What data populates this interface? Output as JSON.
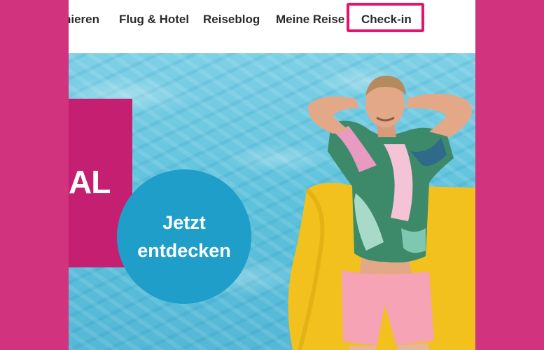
{
  "nav": {
    "items": [
      {
        "label": "hieren"
      },
      {
        "label": "Flug & Hotel"
      },
      {
        "label": "Reiseblog"
      },
      {
        "label": "Meine Reise"
      }
    ],
    "checkin": {
      "label": "Check-in",
      "highlight_color": "#E8116C"
    }
  },
  "hero": {
    "promo_text": "AL",
    "cta": {
      "line1": "Jetzt",
      "line2": "entdecken"
    },
    "colors": {
      "page_background": "#D2337F",
      "promo_box": "#C41F71",
      "cta": "#1E9EC8",
      "cushion": "#F2C11E"
    }
  }
}
